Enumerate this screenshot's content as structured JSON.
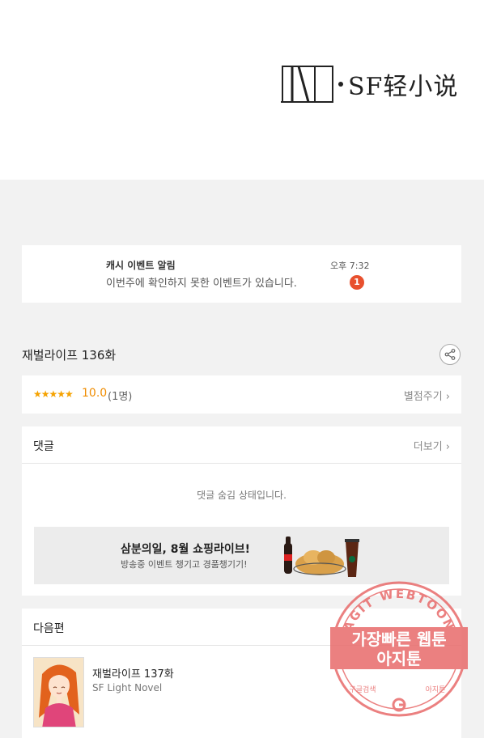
{
  "logo": {
    "text": "SF轻小说"
  },
  "notification": {
    "title": "캐시 이벤트 알림",
    "body": "이번주에 확인하지 못한 이벤트가 있습니다.",
    "time": "오후 7:32",
    "badge": "1"
  },
  "episode": {
    "title": "재벌라이프 136화"
  },
  "rating": {
    "stars": "★★★★★",
    "score": "10.0",
    "count": "(1명)",
    "rate_link": "별점주기 ›"
  },
  "comments": {
    "label": "댓글",
    "more": "더보기 ›",
    "hidden_message": "댓글 숨김 상태입니다."
  },
  "ad": {
    "title": "삼분의일, 8월 쇼핑라이브!",
    "subtitle": "방송중 이벤트 챙기고 경품챙기기!"
  },
  "next_episode": {
    "label": "다음편",
    "title": "재벌라이프 137화",
    "subtitle": "SF Light Novel"
  },
  "watermark": {
    "arc_text": "AGIT WEBTOON",
    "line1": "가장빠른 웹툰",
    "line2": "아지툰",
    "bottom_left": "구글검색",
    "bottom_right": "아지툰"
  },
  "colors": {
    "accent_orange": "#f08c00",
    "badge_red": "#e8502e",
    "stamp_red": "#e86a6a"
  }
}
